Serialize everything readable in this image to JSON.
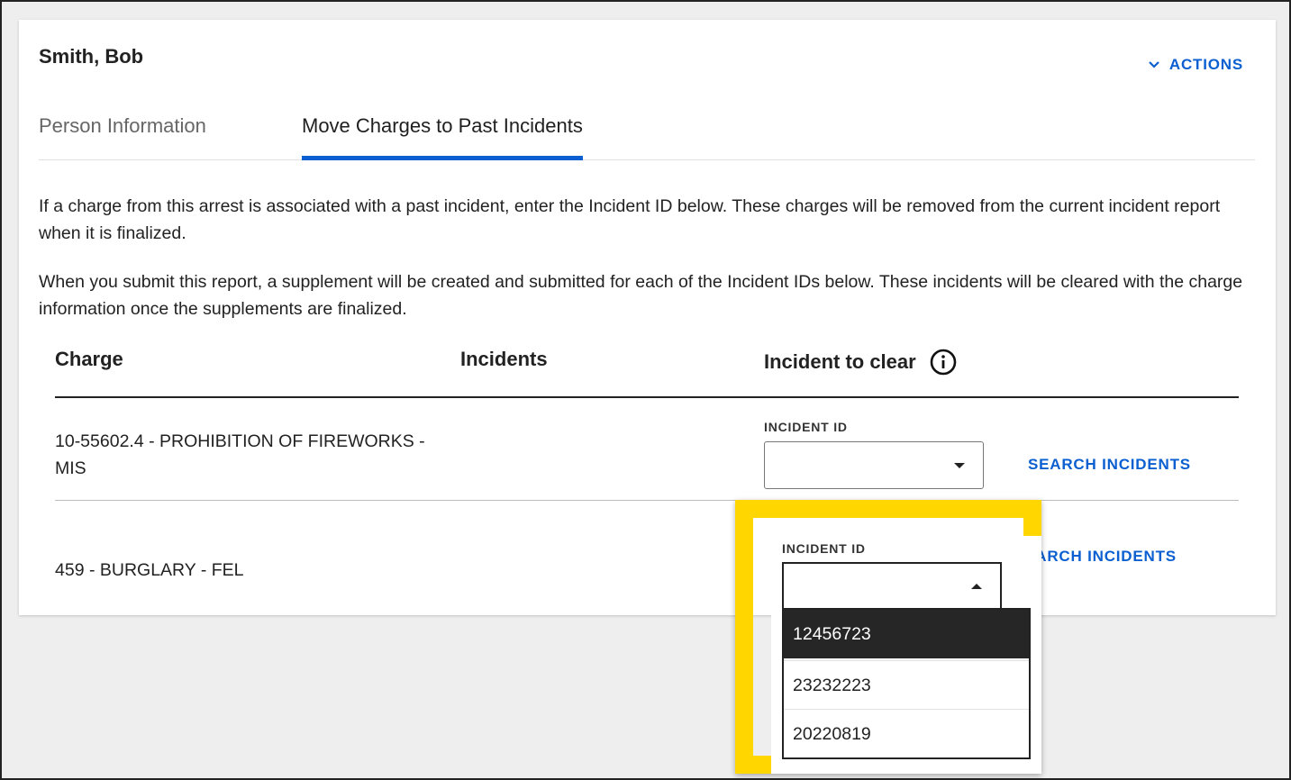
{
  "person": {
    "name": "Smith, Bob"
  },
  "actions": {
    "label": "ACTIONS",
    "icon": "chevron-down-icon"
  },
  "tabs": [
    {
      "label": "Person Information",
      "active": false
    },
    {
      "label": "Move Charges to Past Incidents",
      "active": true
    }
  ],
  "paragraphs": [
    "If a charge from this arrest is associated with a past incident, enter the Incident ID below. These charges will be removed from the current incident report when it is finalized.",
    "When you submit this report, a supplement will be created and submitted for each of the Incident IDs below. These incidents will be cleared with the charge information once the supplements are finalized."
  ],
  "table": {
    "headers": {
      "charge": "Charge",
      "incidents": "Incidents",
      "clear": "Incident to clear"
    },
    "rows": [
      {
        "charge": "10-55602.4 - PROHIBITION OF FIREWORKS - MIS",
        "field_label": "INCIDENT ID",
        "value": "",
        "search_label": "SEARCH INCIDENTS"
      },
      {
        "charge": "459 - BURGLARY - FEL",
        "field_label": "INCIDENT ID",
        "value": "",
        "search_label": "SEARCH INCIDENTS",
        "dropdown_open": true
      }
    ]
  },
  "dropdown": {
    "options": [
      "12456723",
      "23232223",
      "20220819"
    ],
    "highlighted": "12456723"
  },
  "colors": {
    "accent": "#0b5fd0",
    "highlight": "#ffd600",
    "selected_bg": "#262626"
  }
}
